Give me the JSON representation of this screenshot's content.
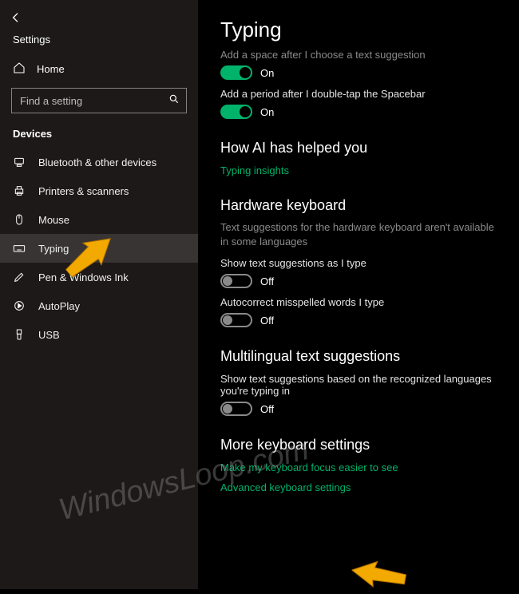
{
  "header": {
    "title": "Settings"
  },
  "home_label": "Home",
  "search": {
    "placeholder": "Find a setting"
  },
  "category": "Devices",
  "nav": [
    {
      "label": "Bluetooth & other devices",
      "icon": "bluetooth"
    },
    {
      "label": "Printers & scanners",
      "icon": "printer"
    },
    {
      "label": "Mouse",
      "icon": "mouse"
    },
    {
      "label": "Typing",
      "icon": "keyboard",
      "selected": true
    },
    {
      "label": "Pen & Windows Ink",
      "icon": "pen"
    },
    {
      "label": "AutoPlay",
      "icon": "autoplay"
    },
    {
      "label": "USB",
      "icon": "usb"
    }
  ],
  "main": {
    "title": "Typing",
    "cut_line": "Add a space after I choose a text suggestion",
    "toggles_top": [
      {
        "state": "On",
        "on": true
      },
      {
        "label": "Add a period after I double-tap the Spacebar",
        "state": "On",
        "on": true
      }
    ],
    "ai_section": {
      "heading": "How AI has helped you",
      "link": "Typing insights"
    },
    "hw_section": {
      "heading": "Hardware keyboard",
      "desc": "Text suggestions for the hardware keyboard aren't available in some languages",
      "items": [
        {
          "label": "Show text suggestions as I type",
          "state": "Off",
          "on": false
        },
        {
          "label": "Autocorrect misspelled words I type",
          "state": "Off",
          "on": false
        }
      ]
    },
    "multi_section": {
      "heading": "Multilingual text suggestions",
      "item": {
        "label": "Show text suggestions based on the recognized languages you're typing in",
        "state": "Off",
        "on": false
      }
    },
    "more_section": {
      "heading": "More keyboard settings",
      "links": [
        "Make my keyboard focus easier to see",
        "Advanced keyboard settings"
      ]
    }
  },
  "watermark": "WindowsLoop.com"
}
